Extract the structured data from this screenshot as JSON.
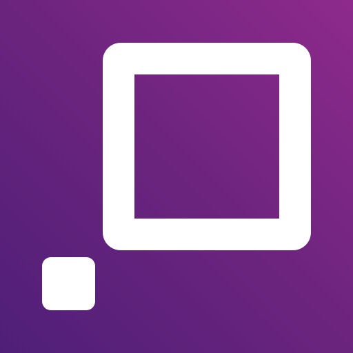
{
  "logo": {
    "icon_name": "square-frame-with-dot-logo",
    "colors": {
      "background_start": "#4f1f78",
      "background_mid": "#6b247e",
      "background_end": "#8e2a8c",
      "foreground": "#ffffff"
    }
  }
}
